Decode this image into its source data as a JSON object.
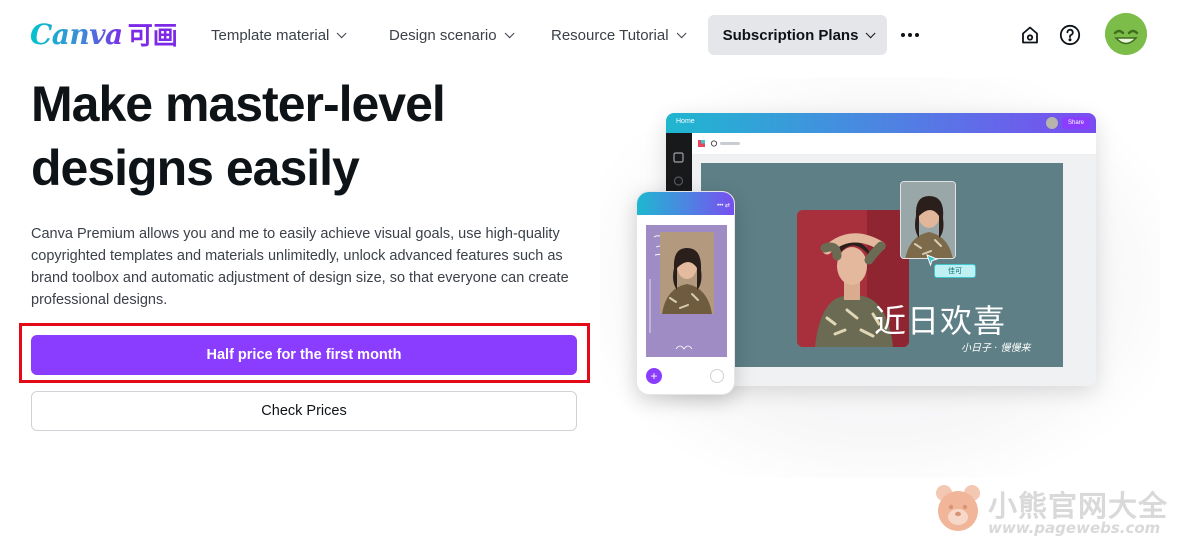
{
  "logo": {
    "text": "Canva",
    "cn": "可画"
  },
  "nav": {
    "items": [
      {
        "label": "Template material"
      },
      {
        "label": "Design scenario"
      },
      {
        "label": "Resource Tutorial"
      },
      {
        "label": "Subscription Plans"
      }
    ],
    "icons": [
      "home-icon",
      "help-icon",
      "more-icon"
    ]
  },
  "hero": {
    "title_line1": "Make master-level",
    "title_line2": "designs easily",
    "description": "Canva Premium allows you and me to easily achieve visual goals, use high-quality copyrighted templates and materials unlimitedly, unlock advanced features such as brand toolbox and automatic adjustment of design size, so that everyone can create professional designs.",
    "primary_button": "Half price for the first month",
    "secondary_button": "Check Prices"
  },
  "illustration": {
    "laptop_home": "Home",
    "laptop_share": "Share",
    "canvas_headline": "近日欢喜",
    "canvas_signature": "小日子 · 慢慢来",
    "canvas_tag": "佳可"
  },
  "watermark": {
    "cn": "小熊官网大全",
    "url": "www.pagewebs.com"
  },
  "colors": {
    "brand_purple": "#8b3dff",
    "highlight_red": "#e30b17",
    "nav_active_bg": "#e4e6e9"
  }
}
